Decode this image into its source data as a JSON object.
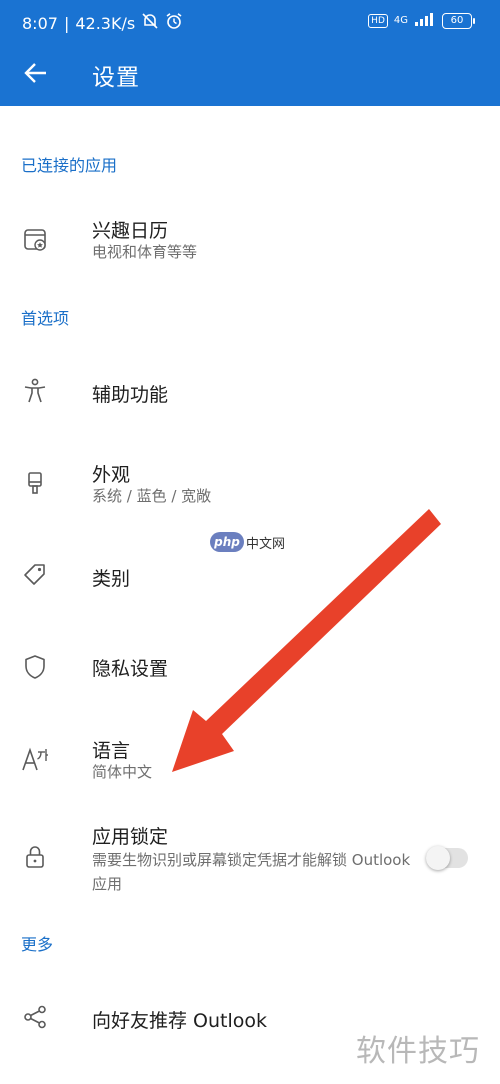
{
  "status_bar": {
    "time": "8:07",
    "speed": "42.3K/s",
    "network": "4G",
    "hd": "HD",
    "battery": "60"
  },
  "header": {
    "title": "设置"
  },
  "sections": {
    "connected_apps": "已连接的应用",
    "preferences": "首选项",
    "more": "更多"
  },
  "items": {
    "interest_calendar": {
      "title": "兴趣日历",
      "subtitle": "电视和体育等等"
    },
    "accessibility": {
      "title": "辅助功能"
    },
    "appearance": {
      "title": "外观",
      "subtitle": "系统 / 蓝色 / 宽敞"
    },
    "categories": {
      "title": "类别"
    },
    "privacy": {
      "title": "隐私设置"
    },
    "language": {
      "title": "语言",
      "subtitle": "简体中文"
    },
    "app_lock": {
      "title": "应用锁定",
      "subtitle": "需要生物识别或屏幕锁定凭据才能解锁 Outlook 应用",
      "enabled": false
    },
    "recommend": {
      "title": "向好友推荐 Outlook"
    }
  },
  "watermarks": {
    "center_logo": "php",
    "center_text": "中文网",
    "corner": "软件技巧"
  },
  "colors": {
    "accent": "#1a73d2",
    "section_text": "#1a6fc8",
    "annotation_arrow": "#e8412a"
  },
  "icons": {
    "back": "arrow-left-icon",
    "interest_calendar": "calendar-icon",
    "accessibility": "accessibility-person-icon",
    "appearance": "paint-brush-icon",
    "categories": "tag-icon",
    "privacy": "shield-icon",
    "language": "language-icon",
    "app_lock": "lock-icon",
    "recommend": "share-icon"
  }
}
